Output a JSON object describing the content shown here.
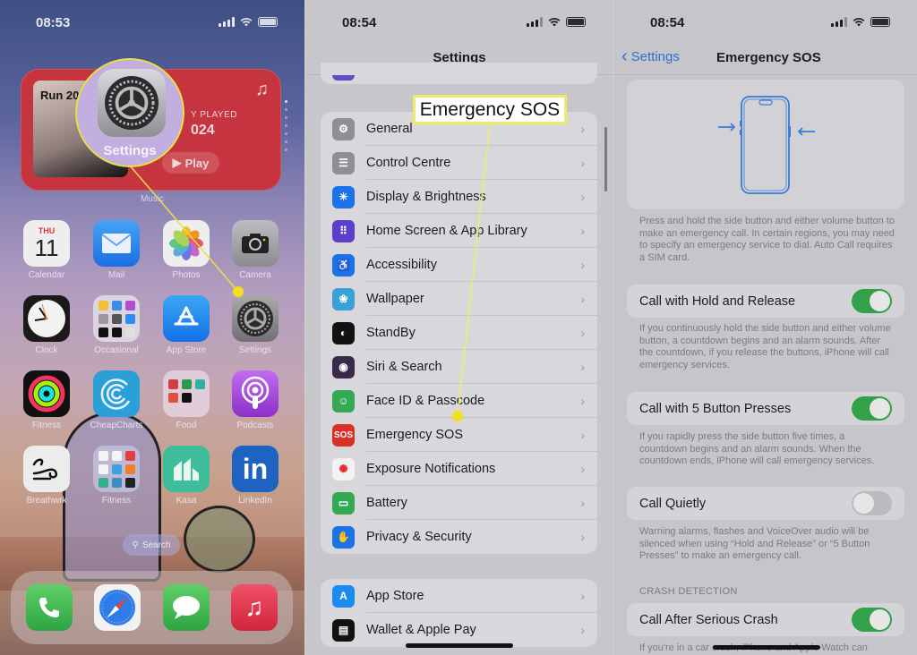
{
  "home_screen": {
    "status_time": "08:53",
    "widget": {
      "album_title": "Run 20",
      "label": "Y PLAYED",
      "year": "024",
      "play_label": "Play",
      "caption": "Music",
      "note_icon": "music-note-icon"
    },
    "magnifier_label": "Settings",
    "apps": [
      {
        "label": "Calendar",
        "icon": "calendar-icon",
        "day": "THU",
        "date": "11"
      },
      {
        "label": "Mail",
        "icon": "mail-icon"
      },
      {
        "label": "Photos",
        "icon": "photos-icon"
      },
      {
        "label": "Camera",
        "icon": "camera-icon"
      },
      {
        "label": "Clock",
        "icon": "clock-icon"
      },
      {
        "label": "Occasional",
        "icon": "folder-icon"
      },
      {
        "label": "App Store",
        "icon": "app-store-icon"
      },
      {
        "label": "Settings",
        "icon": "gear-icon"
      },
      {
        "label": "Fitness",
        "icon": "activity-rings-icon"
      },
      {
        "label": "CheapCharts",
        "icon": "cheapcharts-icon"
      },
      {
        "label": "Food",
        "icon": "folder-icon"
      },
      {
        "label": "Podcasts",
        "icon": "podcasts-icon"
      },
      {
        "label": "Breathwrk",
        "icon": "breath-icon"
      },
      {
        "label": "Fitness",
        "icon": "folder-icon"
      },
      {
        "label": "Kasa",
        "icon": "kasa-icon"
      },
      {
        "label": "LinkedIn",
        "icon": "linkedin-icon"
      }
    ],
    "search_label": "Search",
    "dock": [
      {
        "name": "Phone",
        "icon": "phone-icon"
      },
      {
        "name": "Safari",
        "icon": "compass-icon"
      },
      {
        "name": "Messages",
        "icon": "message-icon"
      },
      {
        "name": "Music",
        "icon": "music-note-icon"
      }
    ]
  },
  "settings_screen": {
    "status_time": "08:54",
    "title": "Settings",
    "callout": "Emergency SOS",
    "group1": [
      {
        "label": "General",
        "icon": "gear-icon",
        "color": "#8e8e93"
      },
      {
        "label": "Control Centre",
        "icon": "toggles-icon",
        "color": "#8e8e93"
      },
      {
        "label": "Display & Brightness",
        "icon": "sun-icon",
        "color": "#1a73e8"
      },
      {
        "label": "Home Screen & App Library",
        "icon": "grid-icon",
        "color": "#5b3fc8"
      },
      {
        "label": "Accessibility",
        "icon": "accessibility-icon",
        "color": "#1a73e8"
      },
      {
        "label": "Wallpaper",
        "icon": "flower-icon",
        "color": "#3aa0d8"
      },
      {
        "label": "StandBy",
        "icon": "standby-icon",
        "color": "#111111"
      },
      {
        "label": "Siri & Search",
        "icon": "siri-icon",
        "color": "#3a2a4a"
      },
      {
        "label": "Face ID & Passcode",
        "icon": "face-id-icon",
        "color": "#34a853"
      },
      {
        "label": "Emergency SOS",
        "icon": "sos-icon",
        "color": "#d93025",
        "glyph": "SOS"
      },
      {
        "label": "Exposure Notifications",
        "icon": "exposure-icon",
        "color": "#f2f2f2"
      },
      {
        "label": "Battery",
        "icon": "battery-icon",
        "color": "#34a853"
      },
      {
        "label": "Privacy & Security",
        "icon": "hand-icon",
        "color": "#1a73e8"
      }
    ],
    "group2": [
      {
        "label": "App Store",
        "icon": "app-store-icon",
        "color": "#1a8cf0"
      },
      {
        "label": "Wallet & Apple Pay",
        "icon": "wallet-icon",
        "color": "#111111"
      }
    ]
  },
  "sos_screen": {
    "status_time": "08:54",
    "back_label": "Settings",
    "title": "Emergency SOS",
    "intro": "Press and hold the side button and either volume button to make an emergency call. In certain regions, you may need to specify an emergency service to dial. Auto Call requires a SIM card.",
    "settings": [
      {
        "label": "Call with Hold and Release",
        "on": true,
        "footnote": "If you continuously hold the side button and either volume button, a countdown begins and an alarm sounds. After the countdown, if you release the buttons, iPhone will call emergency services."
      },
      {
        "label": "Call with 5 Button Presses",
        "on": true,
        "footnote": "If you rapidly press the side button five times, a countdown begins and an alarm sounds. When the countdown ends, iPhone will call emergency services."
      },
      {
        "label": "Call Quietly",
        "on": false,
        "footnote": "Warning alarms, flashes and VoiceOver audio will be silenced when using “Hold and Release” or “5 Button Presses” to make an emergency call."
      }
    ],
    "crash_section_header": "CRASH DETECTION",
    "crash_setting": {
      "label": "Call After Serious Crash",
      "on": true,
      "footnote": "If you're in a car crash, iPhone and Apple Watch can"
    }
  },
  "colors": {
    "accent_yellow": "#ecdd45",
    "toggle_on": "#33a04a",
    "link_blue": "#2f6fd1"
  }
}
